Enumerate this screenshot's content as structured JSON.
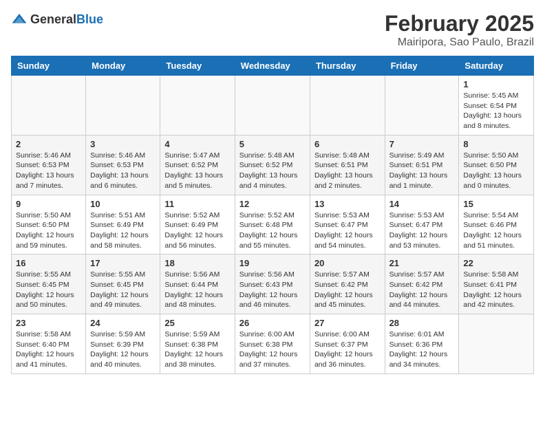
{
  "header": {
    "logo_general": "General",
    "logo_blue": "Blue",
    "month": "February 2025",
    "location": "Mairipora, Sao Paulo, Brazil"
  },
  "weekdays": [
    "Sunday",
    "Monday",
    "Tuesday",
    "Wednesday",
    "Thursday",
    "Friday",
    "Saturday"
  ],
  "weeks": [
    [
      {
        "day": "",
        "info": ""
      },
      {
        "day": "",
        "info": ""
      },
      {
        "day": "",
        "info": ""
      },
      {
        "day": "",
        "info": ""
      },
      {
        "day": "",
        "info": ""
      },
      {
        "day": "",
        "info": ""
      },
      {
        "day": "1",
        "info": "Sunrise: 5:45 AM\nSunset: 6:54 PM\nDaylight: 13 hours and 8 minutes."
      }
    ],
    [
      {
        "day": "2",
        "info": "Sunrise: 5:46 AM\nSunset: 6:53 PM\nDaylight: 13 hours and 7 minutes."
      },
      {
        "day": "3",
        "info": "Sunrise: 5:46 AM\nSunset: 6:53 PM\nDaylight: 13 hours and 6 minutes."
      },
      {
        "day": "4",
        "info": "Sunrise: 5:47 AM\nSunset: 6:52 PM\nDaylight: 13 hours and 5 minutes."
      },
      {
        "day": "5",
        "info": "Sunrise: 5:48 AM\nSunset: 6:52 PM\nDaylight: 13 hours and 4 minutes."
      },
      {
        "day": "6",
        "info": "Sunrise: 5:48 AM\nSunset: 6:51 PM\nDaylight: 13 hours and 2 minutes."
      },
      {
        "day": "7",
        "info": "Sunrise: 5:49 AM\nSunset: 6:51 PM\nDaylight: 13 hours and 1 minute."
      },
      {
        "day": "8",
        "info": "Sunrise: 5:50 AM\nSunset: 6:50 PM\nDaylight: 13 hours and 0 minutes."
      }
    ],
    [
      {
        "day": "9",
        "info": "Sunrise: 5:50 AM\nSunset: 6:50 PM\nDaylight: 12 hours and 59 minutes."
      },
      {
        "day": "10",
        "info": "Sunrise: 5:51 AM\nSunset: 6:49 PM\nDaylight: 12 hours and 58 minutes."
      },
      {
        "day": "11",
        "info": "Sunrise: 5:52 AM\nSunset: 6:49 PM\nDaylight: 12 hours and 56 minutes."
      },
      {
        "day": "12",
        "info": "Sunrise: 5:52 AM\nSunset: 6:48 PM\nDaylight: 12 hours and 55 minutes."
      },
      {
        "day": "13",
        "info": "Sunrise: 5:53 AM\nSunset: 6:47 PM\nDaylight: 12 hours and 54 minutes."
      },
      {
        "day": "14",
        "info": "Sunrise: 5:53 AM\nSunset: 6:47 PM\nDaylight: 12 hours and 53 minutes."
      },
      {
        "day": "15",
        "info": "Sunrise: 5:54 AM\nSunset: 6:46 PM\nDaylight: 12 hours and 51 minutes."
      }
    ],
    [
      {
        "day": "16",
        "info": "Sunrise: 5:55 AM\nSunset: 6:45 PM\nDaylight: 12 hours and 50 minutes."
      },
      {
        "day": "17",
        "info": "Sunrise: 5:55 AM\nSunset: 6:45 PM\nDaylight: 12 hours and 49 minutes."
      },
      {
        "day": "18",
        "info": "Sunrise: 5:56 AM\nSunset: 6:44 PM\nDaylight: 12 hours and 48 minutes."
      },
      {
        "day": "19",
        "info": "Sunrise: 5:56 AM\nSunset: 6:43 PM\nDaylight: 12 hours and 46 minutes."
      },
      {
        "day": "20",
        "info": "Sunrise: 5:57 AM\nSunset: 6:42 PM\nDaylight: 12 hours and 45 minutes."
      },
      {
        "day": "21",
        "info": "Sunrise: 5:57 AM\nSunset: 6:42 PM\nDaylight: 12 hours and 44 minutes."
      },
      {
        "day": "22",
        "info": "Sunrise: 5:58 AM\nSunset: 6:41 PM\nDaylight: 12 hours and 42 minutes."
      }
    ],
    [
      {
        "day": "23",
        "info": "Sunrise: 5:58 AM\nSunset: 6:40 PM\nDaylight: 12 hours and 41 minutes."
      },
      {
        "day": "24",
        "info": "Sunrise: 5:59 AM\nSunset: 6:39 PM\nDaylight: 12 hours and 40 minutes."
      },
      {
        "day": "25",
        "info": "Sunrise: 5:59 AM\nSunset: 6:38 PM\nDaylight: 12 hours and 38 minutes."
      },
      {
        "day": "26",
        "info": "Sunrise: 6:00 AM\nSunset: 6:38 PM\nDaylight: 12 hours and 37 minutes."
      },
      {
        "day": "27",
        "info": "Sunrise: 6:00 AM\nSunset: 6:37 PM\nDaylight: 12 hours and 36 minutes."
      },
      {
        "day": "28",
        "info": "Sunrise: 6:01 AM\nSunset: 6:36 PM\nDaylight: 12 hours and 34 minutes."
      },
      {
        "day": "",
        "info": ""
      }
    ]
  ]
}
